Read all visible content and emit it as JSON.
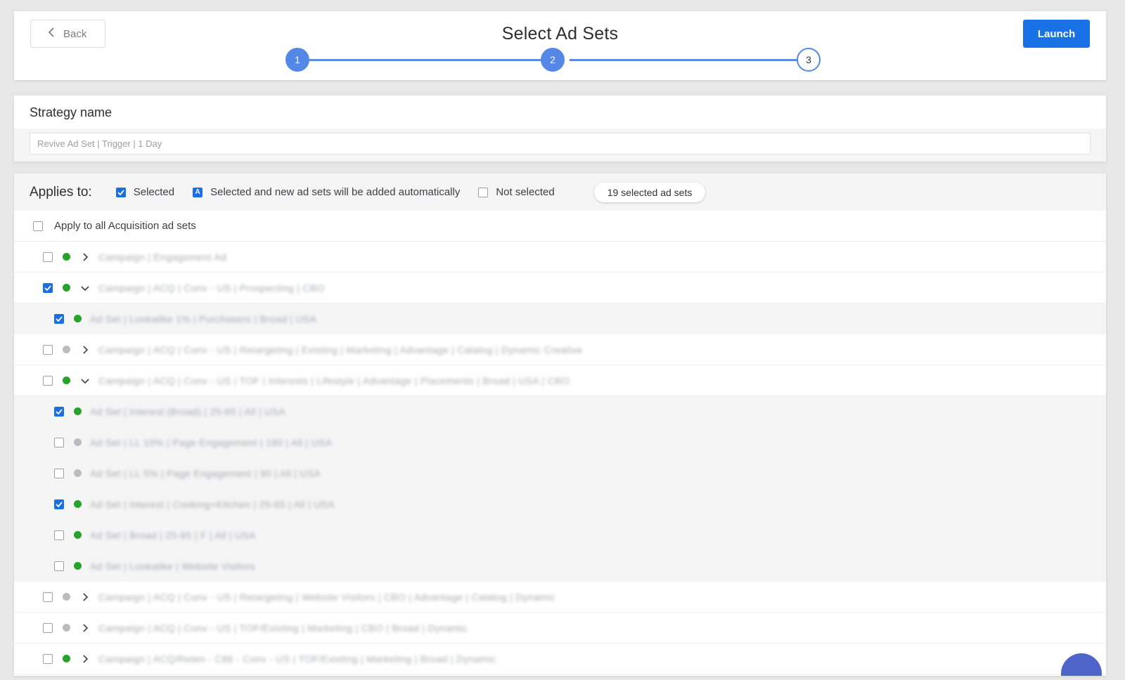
{
  "header": {
    "back_label": "Back",
    "title": "Select Ad Sets",
    "launch_label": "Launch",
    "steps": [
      {
        "label": "1",
        "state": "done"
      },
      {
        "label": "2",
        "state": "done"
      },
      {
        "label": "3",
        "state": "todo"
      }
    ]
  },
  "strategy": {
    "label": "Strategy name",
    "value": "Revive Ad Set | Trigger | 1 Day"
  },
  "applies": {
    "title": "Applies to:",
    "legend_selected": "Selected",
    "legend_auto": "Selected and new ad sets will be added automatically",
    "legend_auto_glyph": "A",
    "legend_not_selected": "Not selected",
    "count": "19 selected ad sets"
  },
  "apply_all_label": "Apply to all Acquisition ad sets",
  "rows": [
    {
      "level": "campaign",
      "checked": false,
      "status": "active",
      "expand": "collapsed",
      "name": "Campaign | Engagement Ad"
    },
    {
      "level": "campaign",
      "checked": true,
      "status": "active",
      "expand": "expanded",
      "name": "Campaign | ACQ | Conv - US | Prospecting | CBO"
    },
    {
      "level": "adset",
      "checked": true,
      "status": "active",
      "expand": "none",
      "name": "Ad Set | Lookalike 1% | Purchasers | Broad | USA"
    },
    {
      "level": "campaign",
      "checked": false,
      "status": "inactive",
      "expand": "collapsed",
      "name": "Campaign | ACQ | Conv - US | Retargeting | Existing | Marketing | Advantage | Catalog | Dynamic Creative"
    },
    {
      "level": "campaign",
      "checked": false,
      "status": "active",
      "expand": "expanded",
      "name": "Campaign | ACQ | Conv - US | TOF | Interests | Lifestyle | Advantage | Placements | Broad | USA | CBO"
    },
    {
      "level": "adset",
      "checked": true,
      "status": "active",
      "expand": "none",
      "name": "Ad Set | Interest (Broad) | 25-65 | All | USA"
    },
    {
      "level": "adset",
      "checked": false,
      "status": "inactive",
      "expand": "none",
      "name": "Ad Set | LL 10% | Page Engagement | 180 | All | USA"
    },
    {
      "level": "adset",
      "checked": false,
      "status": "inactive",
      "expand": "none",
      "name": "Ad Set | LL 5% | Page Engagement | 90 | All | USA"
    },
    {
      "level": "adset",
      "checked": true,
      "status": "active",
      "expand": "none",
      "name": "Ad Set | Interest | Cooking+Kitchen | 25-65 | All | USA"
    },
    {
      "level": "adset",
      "checked": false,
      "status": "active",
      "expand": "none",
      "name": "Ad Set | Broad | 25-65 | F | All | USA"
    },
    {
      "level": "adset",
      "checked": false,
      "status": "active",
      "expand": "none",
      "name": "Ad Set | Lookalike | Website Visitors"
    },
    {
      "level": "campaign",
      "checked": false,
      "status": "inactive",
      "expand": "collapsed",
      "name": "Campaign | ACQ | Conv - US | Retargeting | Website Visitors | CBO | Advantage | Catalog | Dynamic"
    },
    {
      "level": "campaign",
      "checked": false,
      "status": "inactive",
      "expand": "collapsed",
      "name": "Campaign | ACQ | Conv - US | TOF/Existing | Marketing | CBO | Broad | Dynamic"
    },
    {
      "level": "campaign",
      "checked": false,
      "status": "active",
      "expand": "collapsed",
      "name": "Campaign | ACQ/Reten - C86 - Conv - US | TOF/Existing | Marketing | Broad | Dynamic"
    }
  ],
  "colors": {
    "accent": "#1971e6",
    "step": "#5588e6",
    "active_dot": "#27a22a",
    "inactive_dot": "#b9bcc1"
  }
}
